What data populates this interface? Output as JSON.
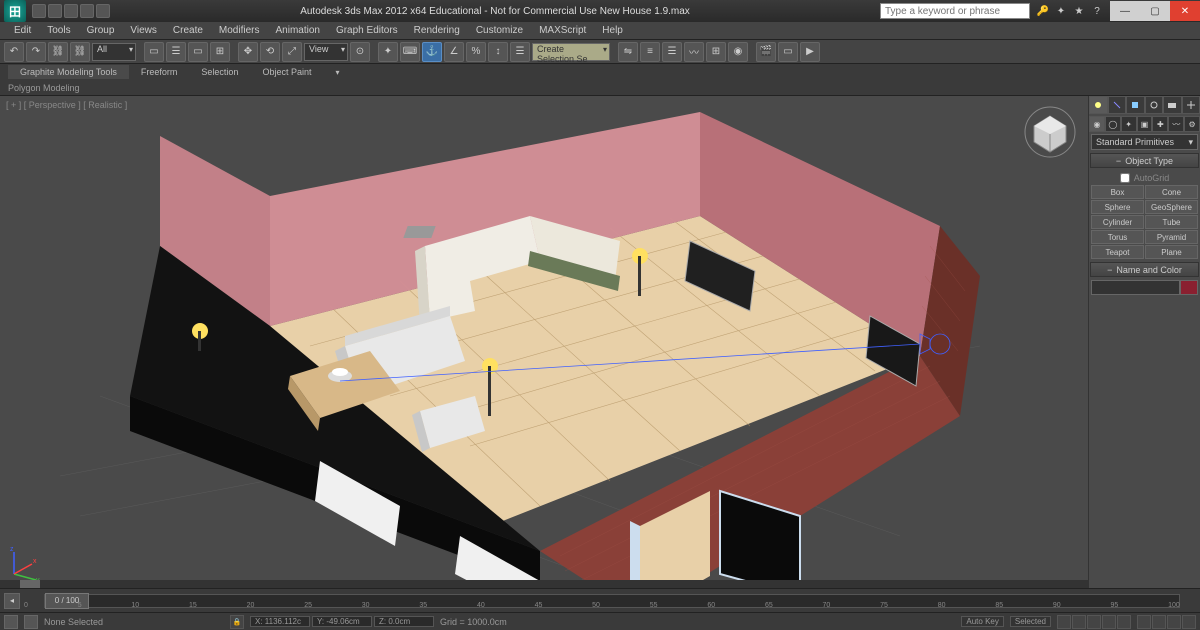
{
  "titlebar": {
    "title": "Autodesk 3ds Max 2012 x64   Educational - Not for Commercial Use   New House 1.9.max",
    "search_placeholder": "Type a keyword or phrase"
  },
  "menu": [
    "Edit",
    "Tools",
    "Group",
    "Views",
    "Create",
    "Modifiers",
    "Animation",
    "Graph Editors",
    "Rendering",
    "Customize",
    "MAXScript",
    "Help"
  ],
  "toolbar": {
    "set_dropdown": "All",
    "view_dropdown": "View",
    "selection_filter": "Create Selection Se"
  },
  "ribbon": {
    "tabs": [
      "Graphite Modeling Tools",
      "Freeform",
      "Selection",
      "Object Paint"
    ],
    "active": 0,
    "sub": "Polygon Modeling"
  },
  "viewport": {
    "label": "[ + ] [ Perspective ] [ Realistic ]"
  },
  "cmdpanel": {
    "category": "Standard Primitives",
    "rollout1": "Object Type",
    "autogrid": "AutoGrid",
    "buttons": [
      "Box",
      "Cone",
      "Sphere",
      "GeoSphere",
      "Cylinder",
      "Tube",
      "Torus",
      "Pyramid",
      "Teapot",
      "Plane"
    ],
    "rollout2": "Name and Color"
  },
  "timeline": {
    "thumb": "0 / 100",
    "ticks": [
      "0",
      "5",
      "10",
      "15",
      "20",
      "25",
      "30",
      "35",
      "40",
      "45",
      "50",
      "55",
      "60",
      "65",
      "70",
      "75",
      "80",
      "85",
      "90",
      "95",
      "100"
    ]
  },
  "status": {
    "selection": "None Selected",
    "x": "X: 1136.112c",
    "y": "Y: -49.06cm",
    "z": "Z: 0.0cm",
    "grid": "Grid = 1000.0cm",
    "autokey": "Auto Key",
    "selmode": "Selected"
  }
}
